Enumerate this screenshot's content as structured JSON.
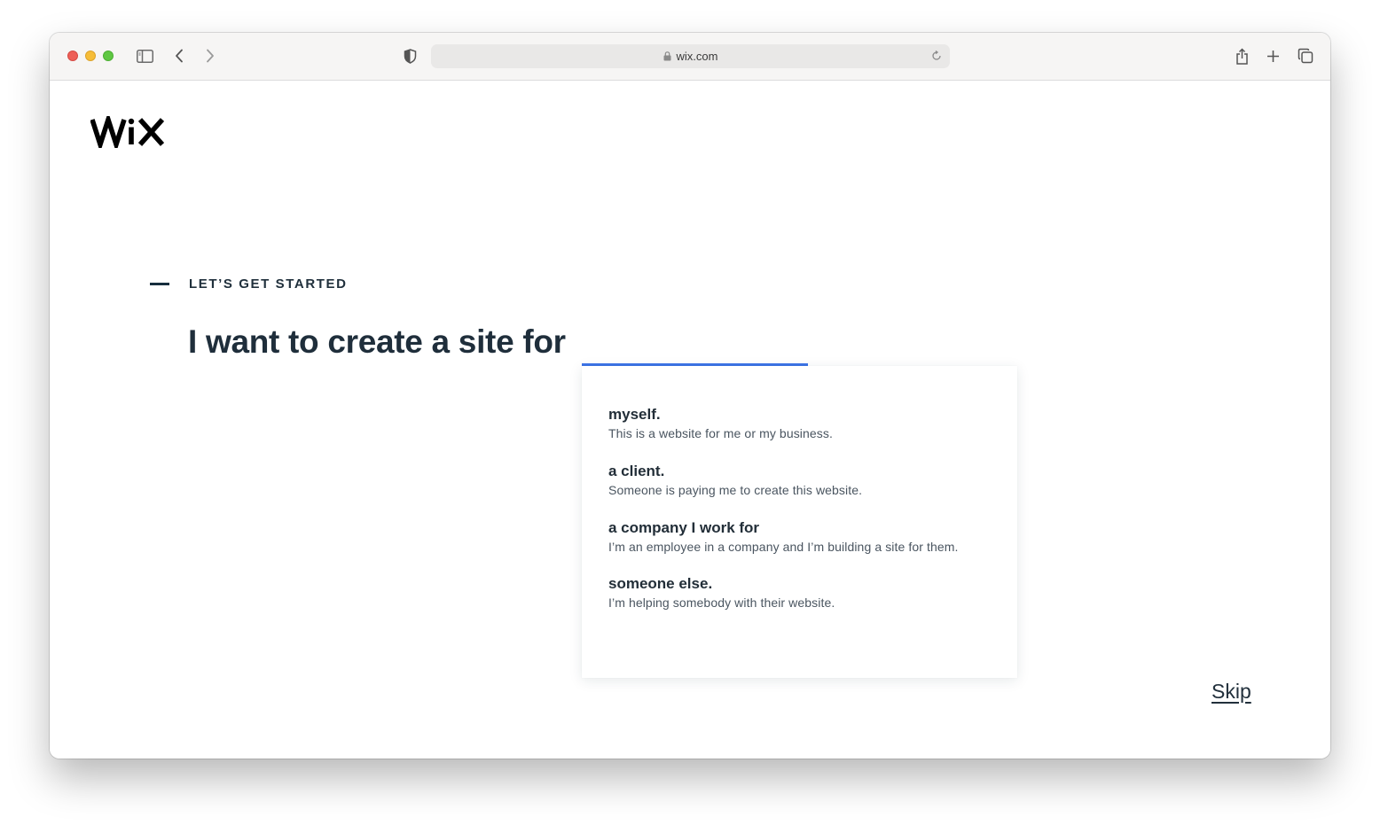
{
  "browser": {
    "url": "wix.com"
  },
  "brand": {
    "logo_text": "WiX"
  },
  "onboarding": {
    "eyebrow": "LET’S GET STARTED",
    "headline": "I want to create a site for",
    "options": [
      {
        "title": "myself.",
        "description": "This is a website for me or my business."
      },
      {
        "title": "a client.",
        "description": "Someone is paying me to create this website."
      },
      {
        "title": "a company I work for",
        "description": "I’m an employee in a company and I’m building a site for them."
      },
      {
        "title": "someone else.",
        "description": "I’m helping somebody with their website."
      }
    ],
    "progress_fraction": 0.52,
    "skip_label": "Skip"
  },
  "colors": {
    "accent_blue": "#3d74e8",
    "text_dark": "#1f2e3b"
  }
}
